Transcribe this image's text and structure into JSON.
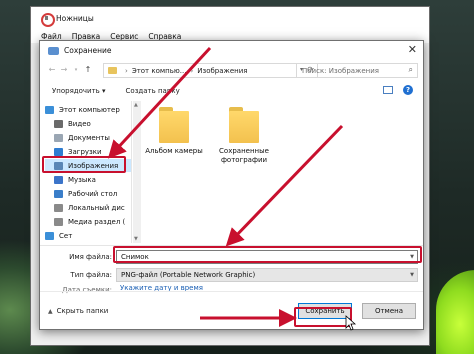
{
  "snip": {
    "title": "Ножницы",
    "menu": [
      "Файл",
      "Правка",
      "Сервис",
      "Справка"
    ]
  },
  "dialog": {
    "title": "Сохранение",
    "close": "✕",
    "address": {
      "root": "Этот компью...",
      "current": "Изображения"
    },
    "search_placeholder": "Поиск: Изображения",
    "toolbar": {
      "organize": "Упорядочить ▾",
      "new_folder": "Создать папку"
    },
    "nav_items": [
      {
        "label": "Этот компьютер",
        "icon": "computer-icon"
      },
      {
        "label": "Видео",
        "icon": "video-icon"
      },
      {
        "label": "Документы",
        "icon": "documents-icon"
      },
      {
        "label": "Загрузки",
        "icon": "downloads-icon"
      },
      {
        "label": "Изображения",
        "icon": "pictures-icon"
      },
      {
        "label": "Музыка",
        "icon": "music-icon"
      },
      {
        "label": "Рабочий стол",
        "icon": "desktop-icon"
      },
      {
        "label": "Локальный дис",
        "icon": "drive-icon"
      },
      {
        "label": "Медиа раздел (",
        "icon": "drive-icon"
      },
      {
        "label": "Сет",
        "icon": "network-icon"
      }
    ],
    "files": [
      {
        "name": "Альбом камеры"
      },
      {
        "name": "Сохраненные фотографии"
      }
    ],
    "filename_label": "Имя файла:",
    "filename_value": "Снимок",
    "filetype_label": "Тип файла:",
    "filetype_value": "PNG-файл (Portable Network Graphic)",
    "date_label": "Дата съемки:",
    "date_link": "Укажите дату и время",
    "hide_folders": "Скрыть папки",
    "save_button": "Сохранить",
    "cancel_button": "Отмена"
  },
  "colors": {
    "highlight": "#c8102e",
    "selection": "#cce8ff",
    "link": "#1a5fb4"
  }
}
